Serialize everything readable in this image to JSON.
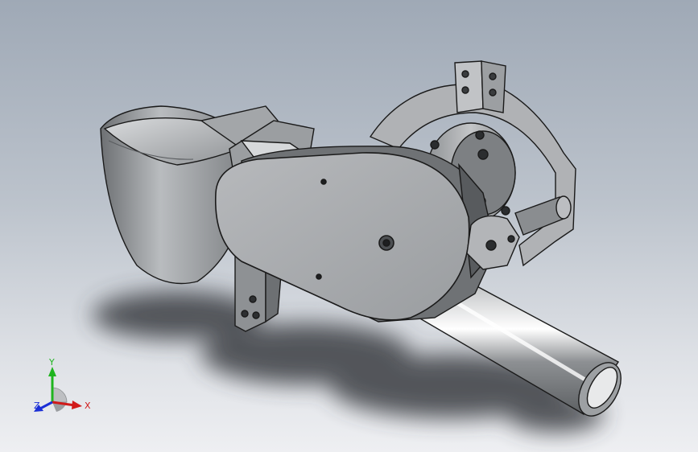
{
  "viewport": {
    "model": "gripper-assembly"
  },
  "triad": {
    "x_label": "X",
    "y_label": "Y",
    "z_label": "Z",
    "x_color": "#d11a1a",
    "y_color": "#1fb41f",
    "z_color": "#1b2fd6"
  },
  "colors": {
    "background_top": "#9fa9b6",
    "background_bottom": "#eeeff2",
    "part_face": "#a9abae",
    "part_edge": "#1a1a1a"
  }
}
